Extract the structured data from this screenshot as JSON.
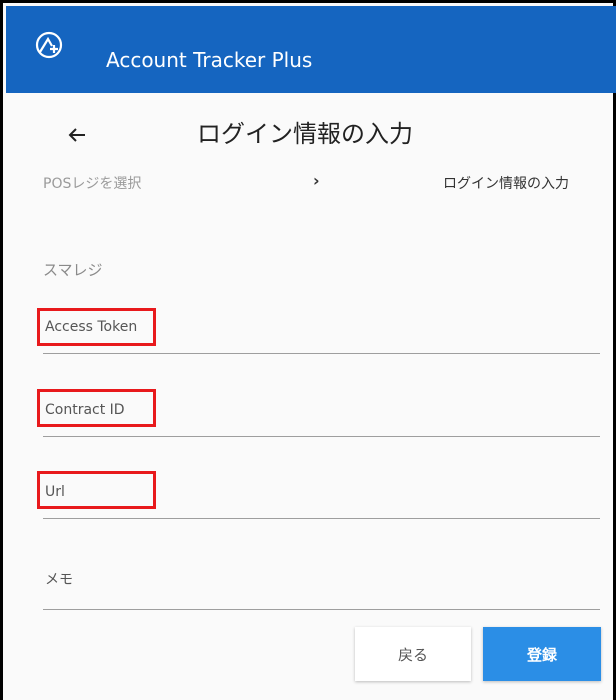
{
  "app": {
    "title": "Account Tracker Plus",
    "brand_color": "#1565c0"
  },
  "header": {
    "back_icon": "arrow-left-icon",
    "page_title": "ログイン情報の入力"
  },
  "stepper": {
    "step1": "POSレジを選択",
    "separator_icon": "chevron-right-icon",
    "step2": "ログイン情報の入力"
  },
  "form": {
    "section": "スマレジ",
    "fields": [
      {
        "label": "Access Token",
        "value": "",
        "highlighted": true
      },
      {
        "label": "Contract ID",
        "value": "",
        "highlighted": true
      },
      {
        "label": "Url",
        "value": "",
        "highlighted": true
      },
      {
        "label": "メモ",
        "value": "",
        "highlighted": false
      }
    ]
  },
  "actions": {
    "back_label": "戻る",
    "submit_label": "登録",
    "submit_color": "#2b8ee6"
  },
  "annotation_color": "#e8191c"
}
